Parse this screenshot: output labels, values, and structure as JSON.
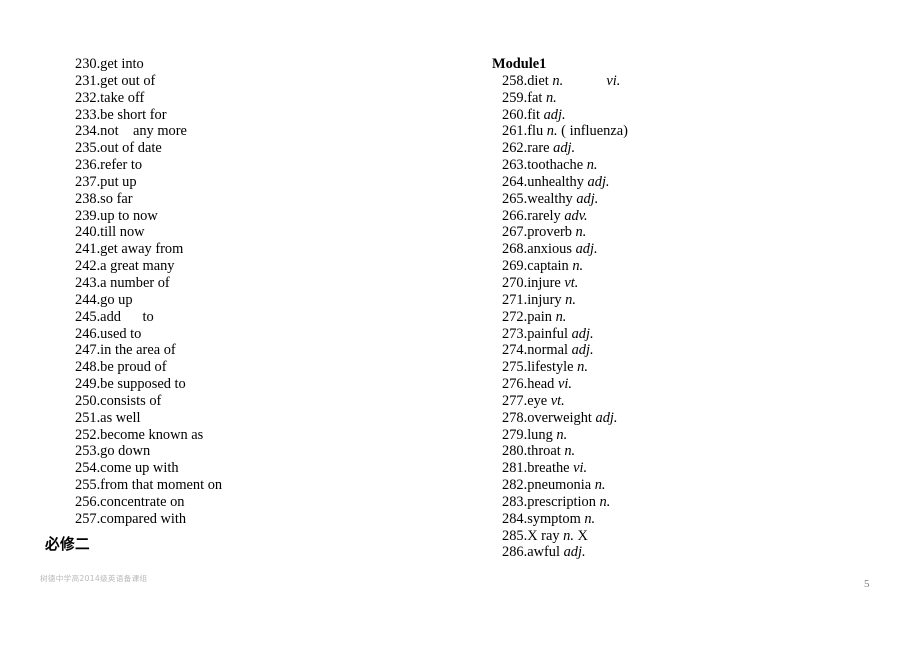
{
  "document": {
    "page_number": "5",
    "footer_watermark": "树德中学高2014级英语备课组",
    "unit_heading": "必修二"
  },
  "left_column": {
    "items": [
      "230.get into",
      "231.get out of",
      "232.take off",
      "233.be short for",
      "234.not    any more",
      "235.out of date",
      "236.refer to",
      "237.put up",
      "238.so far",
      "239.up to now",
      "240.till now",
      "241.get away from",
      "242.a great many",
      "243.a number of",
      "244.go up",
      "245.add      to",
      "246.used to",
      "247.in the area of",
      "248.be proud of",
      "249.be supposed to",
      "250.consists of",
      "251.as well",
      "252.become known as",
      "253.go down",
      "254.come up with",
      "255.from that moment on",
      "256.concentrate on",
      "257.compared with"
    ]
  },
  "right_column": {
    "module_heading": "Module1",
    "entries": [
      {
        "number": "258.",
        "word": "diet ",
        "pos": "n.",
        "extra": "            ",
        "pos2": "vi.",
        "tail": ""
      },
      {
        "number": "259.",
        "word": "fat ",
        "pos": "n.",
        "extra": "",
        "pos2": "",
        "tail": ""
      },
      {
        "number": "260.",
        "word": "fit ",
        "pos": "adj.",
        "extra": "",
        "pos2": "",
        "tail": ""
      },
      {
        "number": "261.",
        "word": "flu ",
        "pos": "n.",
        "extra": " ( influenza)",
        "pos2": "",
        "tail": ""
      },
      {
        "number": "262.",
        "word": "rare ",
        "pos": "adj.",
        "extra": "",
        "pos2": "",
        "tail": ""
      },
      {
        "number": "263.",
        "word": "toothache ",
        "pos": "n.",
        "extra": "",
        "pos2": "",
        "tail": ""
      },
      {
        "number": "264.",
        "word": "unhealthy ",
        "pos": "adj.",
        "extra": "",
        "pos2": "",
        "tail": ""
      },
      {
        "number": "265.",
        "word": "wealthy ",
        "pos": "adj.",
        "extra": "",
        "pos2": "",
        "tail": ""
      },
      {
        "number": "266.",
        "word": "rarely ",
        "pos": "adv.",
        "extra": "",
        "pos2": "",
        "tail": ""
      },
      {
        "number": "267.",
        "word": "proverb ",
        "pos": "n.",
        "extra": "",
        "pos2": "",
        "tail": ""
      },
      {
        "number": "268.",
        "word": "anxious ",
        "pos": "adj.",
        "extra": "",
        "pos2": "",
        "tail": ""
      },
      {
        "number": "269.",
        "word": "captain ",
        "pos": "n.",
        "extra": "",
        "pos2": "",
        "tail": ""
      },
      {
        "number": "270.",
        "word": "injure ",
        "pos": "vt.",
        "extra": "",
        "pos2": "",
        "tail": ""
      },
      {
        "number": "271.",
        "word": "injury ",
        "pos": "n.",
        "extra": "",
        "pos2": "",
        "tail": ""
      },
      {
        "number": "272.",
        "word": "pain ",
        "pos": "n.",
        "extra": "",
        "pos2": "",
        "tail": ""
      },
      {
        "number": "273.",
        "word": "painful ",
        "pos": "adj.",
        "extra": "",
        "pos2": "",
        "tail": ""
      },
      {
        "number": "274.",
        "word": "normal ",
        "pos": "adj.",
        "extra": "",
        "pos2": "",
        "tail": ""
      },
      {
        "number": "275.",
        "word": "lifestyle ",
        "pos": "n.",
        "extra": "",
        "pos2": "",
        "tail": ""
      },
      {
        "number": "276.",
        "word": "head ",
        "pos": "vi.",
        "extra": "",
        "pos2": "",
        "tail": ""
      },
      {
        "number": "277.",
        "word": "eye ",
        "pos": "vt.",
        "extra": "",
        "pos2": "",
        "tail": ""
      },
      {
        "number": "278.",
        "word": "overweight ",
        "pos": "adj.",
        "extra": "",
        "pos2": "",
        "tail": ""
      },
      {
        "number": "279.",
        "word": "lung ",
        "pos": "n.",
        "extra": "",
        "pos2": "",
        "tail": ""
      },
      {
        "number": "280.",
        "word": "throat ",
        "pos": "n.",
        "extra": "",
        "pos2": "",
        "tail": ""
      },
      {
        "number": "281.",
        "word": "breathe ",
        "pos": "vi.",
        "extra": "",
        "pos2": "",
        "tail": ""
      },
      {
        "number": "282.",
        "word": "pneumonia ",
        "pos": "n.",
        "extra": "",
        "pos2": "",
        "tail": ""
      },
      {
        "number": "283.",
        "word": "prescription ",
        "pos": "n.",
        "extra": "",
        "pos2": "",
        "tail": ""
      },
      {
        "number": "284.",
        "word": "symptom ",
        "pos": "n.",
        "extra": "",
        "pos2": "",
        "tail": ""
      },
      {
        "number": "285.",
        "word": "X ray ",
        "pos": "n.",
        "extra": " X",
        "pos2": "",
        "tail": ""
      },
      {
        "number": "286.",
        "word": "awful ",
        "pos": "adj.",
        "extra": "",
        "pos2": "",
        "tail": ""
      }
    ]
  }
}
